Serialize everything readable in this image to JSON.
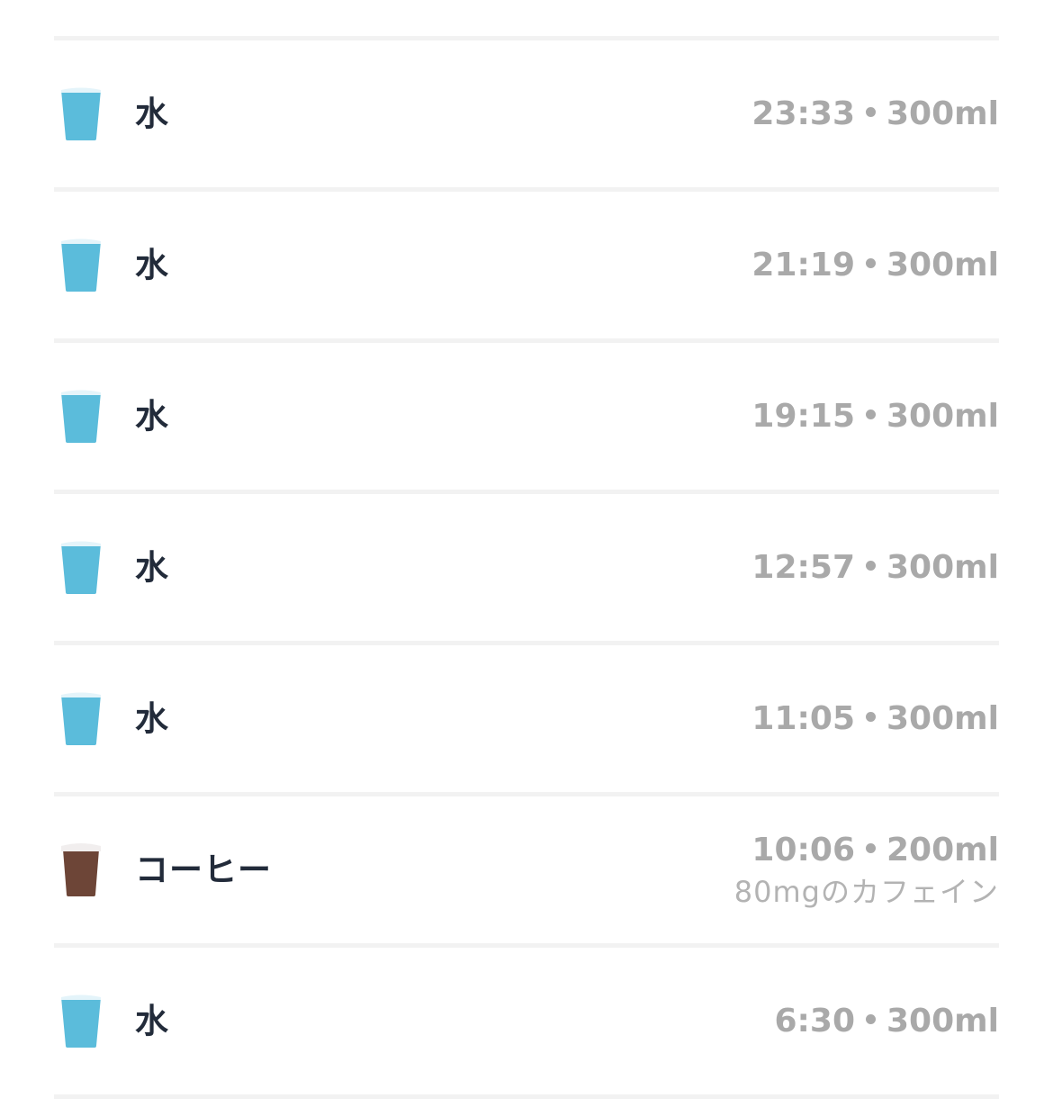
{
  "colors": {
    "water_cup": "#5bbcdb",
    "water_top": "#e4f4fa",
    "coffee_cup": "#6d4537",
    "coffee_lid": "#f1eeee",
    "title_text": "#222b3a",
    "meta_text": "#a9a9a9",
    "divider": "#f2f2f2"
  },
  "entries": [
    {
      "icon": "water-cup-icon",
      "name": "水",
      "time": "23:33",
      "amount": "300ml",
      "note": ""
    },
    {
      "icon": "water-cup-icon",
      "name": "水",
      "time": "21:19",
      "amount": "300ml",
      "note": ""
    },
    {
      "icon": "water-cup-icon",
      "name": "水",
      "time": "19:15",
      "amount": "300ml",
      "note": ""
    },
    {
      "icon": "water-cup-icon",
      "name": "水",
      "time": "12:57",
      "amount": "300ml",
      "note": ""
    },
    {
      "icon": "water-cup-icon",
      "name": "水",
      "time": "11:05",
      "amount": "300ml",
      "note": ""
    },
    {
      "icon": "coffee-cup-icon",
      "name": "コーヒー",
      "time": "10:06",
      "amount": "200ml",
      "note": "80mgのカフェイン"
    },
    {
      "icon": "water-cup-icon",
      "name": "水",
      "time": "6:30",
      "amount": "300ml",
      "note": ""
    }
  ]
}
